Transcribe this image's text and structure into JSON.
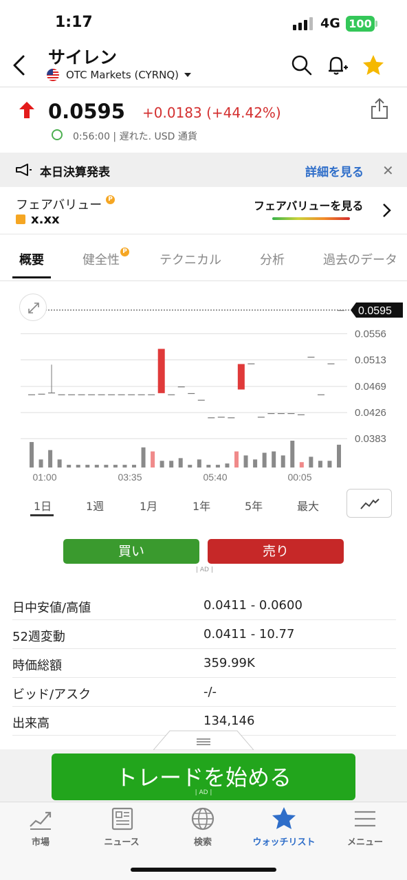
{
  "status_bar": {
    "time": "1:17",
    "network": "4G",
    "battery": "100"
  },
  "header": {
    "title": "サイレン",
    "exchange": "OTC Markets (CYRNQ)"
  },
  "quote": {
    "price": "0.0595",
    "change": "+0.0183 (+44.42%)",
    "delay_info": "0:56:00 | 遅れた. USD 通貨"
  },
  "earnings_banner": {
    "text": "本日決算発表",
    "link": "詳細を見る"
  },
  "fair_value": {
    "label": "フェアバリュー",
    "value": "x.xx",
    "link": "フェアバリューを見る"
  },
  "tabs": [
    "概要",
    "健全性",
    "テクニカル",
    "分析",
    "過去のデータ"
  ],
  "chart_data": {
    "type": "candlestick",
    "current_price_label": "0.0595",
    "current_price": 0.0595,
    "y_ticks": [
      "0.0556",
      "0.0513",
      "0.0469",
      "0.0426",
      "0.0383"
    ],
    "y_tick_values": [
      0.0556,
      0.0513,
      0.0469,
      0.0426,
      0.0383
    ],
    "ylim": [
      0.0383,
      0.0595
    ],
    "x_ticks": [
      "01:00",
      "03:35",
      "05:40",
      "00:05"
    ],
    "candles": [
      {
        "o": 0.0456,
        "h": 0.0456,
        "l": 0.0456,
        "c": 0.0456
      },
      {
        "o": 0.0457,
        "h": 0.0457,
        "l": 0.0457,
        "c": 0.0457
      },
      {
        "o": 0.0459,
        "h": 0.0505,
        "l": 0.0459,
        "c": 0.0459
      },
      {
        "o": 0.0456,
        "h": 0.0456,
        "l": 0.0456,
        "c": 0.0456
      },
      {
        "o": 0.0456,
        "h": 0.0456,
        "l": 0.0456,
        "c": 0.0456
      },
      {
        "o": 0.0456,
        "h": 0.0456,
        "l": 0.0456,
        "c": 0.0456
      },
      {
        "o": 0.0456,
        "h": 0.0456,
        "l": 0.0456,
        "c": 0.0456
      },
      {
        "o": 0.0456,
        "h": 0.0456,
        "l": 0.0456,
        "c": 0.0456
      },
      {
        "o": 0.0456,
        "h": 0.0456,
        "l": 0.0456,
        "c": 0.0456
      },
      {
        "o": 0.0456,
        "h": 0.0456,
        "l": 0.0456,
        "c": 0.0456
      },
      {
        "o": 0.0456,
        "h": 0.0456,
        "l": 0.0456,
        "c": 0.0456
      },
      {
        "o": 0.0456,
        "h": 0.0456,
        "l": 0.0456,
        "c": 0.0456
      },
      {
        "o": 0.0456,
        "h": 0.0456,
        "l": 0.0456,
        "c": 0.0456
      },
      {
        "o": 0.0458,
        "h": 0.0531,
        "l": 0.0458,
        "c": 0.0531
      },
      {
        "o": 0.0456,
        "h": 0.0456,
        "l": 0.0456,
        "c": 0.0456
      },
      {
        "o": 0.0469,
        "h": 0.0469,
        "l": 0.0469,
        "c": 0.0469
      },
      {
        "o": 0.0458,
        "h": 0.0458,
        "l": 0.0458,
        "c": 0.0458
      },
      {
        "o": 0.0447,
        "h": 0.0447,
        "l": 0.0447,
        "c": 0.0447
      },
      {
        "o": 0.0418,
        "h": 0.0418,
        "l": 0.0418,
        "c": 0.0418
      },
      {
        "o": 0.0419,
        "h": 0.0419,
        "l": 0.0419,
        "c": 0.0419
      },
      {
        "o": 0.0418,
        "h": 0.0418,
        "l": 0.0418,
        "c": 0.0418
      },
      {
        "o": 0.0464,
        "h": 0.0506,
        "l": 0.0464,
        "c": 0.0506
      },
      {
        "o": 0.0507,
        "h": 0.0507,
        "l": 0.0507,
        "c": 0.0507
      },
      {
        "o": 0.0419,
        "h": 0.0419,
        "l": 0.0419,
        "c": 0.0419
      },
      {
        "o": 0.0425,
        "h": 0.0425,
        "l": 0.0425,
        "c": 0.0425
      },
      {
        "o": 0.0425,
        "h": 0.0425,
        "l": 0.0425,
        "c": 0.0425
      },
      {
        "o": 0.0425,
        "h": 0.0425,
        "l": 0.0425,
        "c": 0.0425
      },
      {
        "o": 0.0423,
        "h": 0.0423,
        "l": 0.0423,
        "c": 0.0423
      },
      {
        "o": 0.0518,
        "h": 0.0518,
        "l": 0.0518,
        "c": 0.0518
      },
      {
        "o": 0.0456,
        "h": 0.0456,
        "l": 0.0456,
        "c": 0.0456
      },
      {
        "o": 0.0507,
        "h": 0.0507,
        "l": 0.0507,
        "c": 0.0507
      },
      {
        "o": 0.0595,
        "h": 0.0595,
        "l": 0.0595,
        "c": 0.0595
      }
    ],
    "volumes": [
      0.95,
      0.3,
      0.65,
      0.3,
      0.1,
      0.1,
      0.1,
      0.1,
      0.1,
      0.1,
      0.1,
      0.1,
      0.75,
      0.6,
      0.25,
      0.25,
      0.35,
      0.1,
      0.3,
      0.1,
      0.1,
      0.15,
      0.6,
      0.45,
      0.3,
      0.55,
      0.6,
      0.45,
      1.0,
      0.2,
      0.4,
      0.25,
      0.25,
      0.85
    ],
    "volume_up": [
      false,
      false,
      false,
      false,
      false,
      false,
      false,
      false,
      false,
      false,
      false,
      false,
      false,
      true,
      false,
      false,
      false,
      false,
      false,
      false,
      false,
      false,
      true,
      false,
      false,
      false,
      false,
      false,
      false,
      true,
      false,
      false,
      false,
      false
    ],
    "colors": {
      "up": "#e03a3a",
      "neutral": "#777777",
      "vol_up": "#f08a8a",
      "vol": "#8a8a8a",
      "grid": "#dddddd"
    }
  },
  "periods": [
    "1日",
    "1週",
    "1月",
    "1年",
    "5年",
    "最大"
  ],
  "trade": {
    "buy": "買い",
    "sell": "売り",
    "ad": "| AD |"
  },
  "stats": [
    {
      "label": "日中安値/高値",
      "value": "0.0411 - 0.0600"
    },
    {
      "label": "52週変動",
      "value": "0.0411 - 10.77"
    },
    {
      "label": "時価総額",
      "value": "359.99K"
    },
    {
      "label": "ビッド/アスク",
      "value": "-/-"
    },
    {
      "label": "出来高",
      "value": "134,146"
    }
  ],
  "cta": {
    "label": "トレードを始める",
    "ad": "| AD |"
  },
  "bottom_nav": [
    {
      "label": "市場",
      "icon": "chart-icon"
    },
    {
      "label": "ニュース",
      "icon": "newspaper-icon"
    },
    {
      "label": "検索",
      "icon": "globe-icon"
    },
    {
      "label": "ウォッチリスト",
      "icon": "star-icon"
    },
    {
      "label": "メニュー",
      "icon": "menu-icon"
    }
  ],
  "accent_colors": {
    "green": "#22a51c",
    "red": "#d32f2f",
    "blue": "#2f6ec9",
    "star": "#f5b800"
  }
}
